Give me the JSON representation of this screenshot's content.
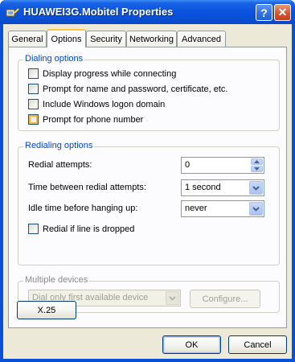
{
  "window": {
    "title": "HUAWEI3G.Mobitel Properties"
  },
  "titlebar": {
    "help_glyph": "?",
    "close_glyph": "✕"
  },
  "tabs": [
    {
      "label": "General"
    },
    {
      "label": "Options"
    },
    {
      "label": "Security"
    },
    {
      "label": "Networking"
    },
    {
      "label": "Advanced"
    }
  ],
  "dialing": {
    "title": "Dialing options",
    "options": [
      {
        "label": "Display progress while connecting",
        "checked": false
      },
      {
        "label": "Prompt for name and password, certificate, etc.",
        "checked": false
      },
      {
        "label": "Include Windows logon domain",
        "checked": false
      },
      {
        "label": "Prompt for phone number",
        "checked": false
      }
    ]
  },
  "redialing": {
    "title": "Redialing options",
    "attempts_label": "Redial attempts:",
    "attempts_value": "0",
    "between_label": "Time between redial attempts:",
    "between_value": "1 second",
    "idle_label": "Idle time before hanging up:",
    "idle_value": "never",
    "redial_dropped_label": "Redial if line is dropped"
  },
  "multiple": {
    "title": "Multiple devices",
    "select_value": "Dial only first available device",
    "configure_label": "Configure..."
  },
  "x25_label": "X.25",
  "footer": {
    "ok_label": "OK",
    "cancel_label": "Cancel"
  },
  "colors": {
    "accent": "#0046d5",
    "titlebar": "#0a54de",
    "face": "#ece9d8"
  }
}
